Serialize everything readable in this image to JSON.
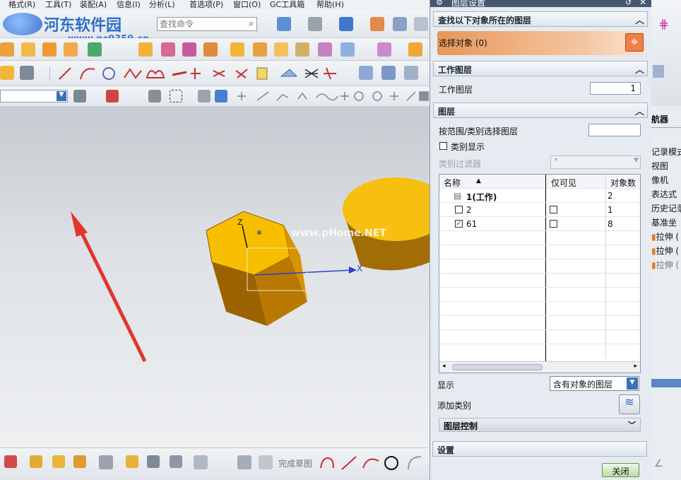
{
  "menu": {
    "items": [
      "格式(R)",
      "工具(T)",
      "装配(A)",
      "信息(I)",
      "分析(L)",
      "首选项(P)",
      "窗口(O)",
      "GC工具箱",
      "帮助(H)"
    ]
  },
  "search": {
    "placeholder": "查找命令"
  },
  "watermark": {
    "brand": "河东软件园",
    "url": "www.pc0359.cn",
    "canvas_text": "www.pHome.NET"
  },
  "axes": {
    "x": "X",
    "z": "Z"
  },
  "dialog": {
    "title": "图层设置",
    "find_section": "查找以下对象所在的图层",
    "select_objects": "选择对象 (0)",
    "work_layer_section": "工作图层",
    "work_layer_label": "工作图层",
    "work_layer_value": "1",
    "layers_section": "图层",
    "range_label": "按范围/类别选择图层",
    "category_display": "类别显示",
    "category_filter_label": "类别过滤器",
    "category_filter_value": "*",
    "columns": [
      "名称",
      "仅可见",
      "对象数"
    ],
    "rows": [
      {
        "name": "1(工作)",
        "objects": "2"
      },
      {
        "name": "2",
        "objects": "1"
      },
      {
        "name": "61",
        "objects": "8"
      }
    ],
    "display_label": "显示",
    "display_value": "含有对象的图层",
    "add_category_label": "添加类别",
    "layer_control": "图层控制",
    "settings_section": "设置",
    "close_button": "关闭",
    "colors": {
      "accent": "#e89a5a",
      "header": "#46586f"
    }
  },
  "navigator": {
    "title": "航器",
    "items": [
      "记录模式",
      "视图",
      "像机",
      "表达式",
      "历史记录",
      "基准坐",
      "拉伸 (",
      "拉伸 (",
      "拉伸 ("
    ]
  },
  "bottom": {
    "finish_sketch": "完成草图"
  }
}
